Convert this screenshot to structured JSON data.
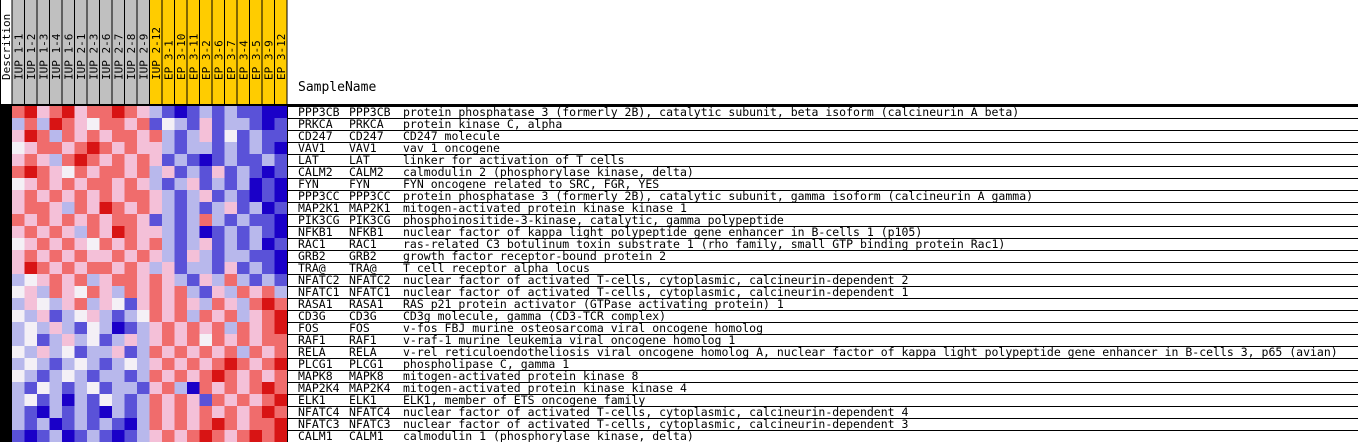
{
  "header": {
    "sample_name_label": "SampleName"
  },
  "chart_data": {
    "type": "heatmap",
    "description_label": "Descrition",
    "columns": [
      {
        "name": "IUP_1-1",
        "group": "IUP"
      },
      {
        "name": "IUP_1-2",
        "group": "IUP"
      },
      {
        "name": "IUP_1-3",
        "group": "IUP"
      },
      {
        "name": "IUP_1-4",
        "group": "IUP"
      },
      {
        "name": "IUP_1-6",
        "group": "IUP"
      },
      {
        "name": "IUP_2-1",
        "group": "IUP"
      },
      {
        "name": "IUP_2-3",
        "group": "IUP"
      },
      {
        "name": "IUP_2-6",
        "group": "IUP"
      },
      {
        "name": "IUP_2-7",
        "group": "IUP"
      },
      {
        "name": "IUP_2-8",
        "group": "IUP"
      },
      {
        "name": "IUP_2-9",
        "group": "IUP"
      },
      {
        "name": "IUP_2-12",
        "group": "EP"
      },
      {
        "name": "EP_3-1",
        "group": "EP"
      },
      {
        "name": "EP_3-10",
        "group": "EP"
      },
      {
        "name": "EP_3-11",
        "group": "EP"
      },
      {
        "name": "EP_3-2",
        "group": "EP"
      },
      {
        "name": "EP_3-6",
        "group": "EP"
      },
      {
        "name": "EP_3-7",
        "group": "EP"
      },
      {
        "name": "EP_3-4",
        "group": "EP"
      },
      {
        "name": "EP_3-5",
        "group": "EP"
      },
      {
        "name": "EP_3-9",
        "group": "EP"
      },
      {
        "name": "EP_3-12",
        "group": "EP"
      }
    ],
    "group_colors": {
      "IUP": "#c0c0c0",
      "EP": "#ffcc00"
    },
    "color_scale": {
      "-3": "#1a00c8",
      "-2": "#5a52d8",
      "-1": "#b8b8ec",
      "0": "#f4f0f6",
      "1": "#f4c0d8",
      "2": "#f06c6c",
      "3": "#d81414"
    },
    "rows": [
      {
        "symbol": "PPP3CB",
        "gene": "PPP3CB",
        "description": "protein phosphatase 3 (formerly 2B), catalytic subunit, beta isoform (calcineurin A beta)",
        "values": [
          2,
          3,
          1,
          2,
          3,
          1,
          2,
          2,
          3,
          2,
          1,
          -1,
          -2,
          -3,
          -2,
          -1,
          -2,
          -1,
          -2,
          -2,
          -3,
          -3
        ]
      },
      {
        "symbol": "PRKCA",
        "gene": "PRKCA",
        "description": "protein kinase C, alpha",
        "values": [
          -1,
          2,
          -1,
          3,
          2,
          1,
          0,
          2,
          2,
          1,
          2,
          -2,
          0,
          -1,
          -2,
          1,
          -2,
          -1,
          -1,
          -2,
          -3,
          -2
        ]
      },
      {
        "symbol": "CD247",
        "gene": "CD247",
        "description": "CD247 molecule",
        "values": [
          1,
          3,
          2,
          -1,
          2,
          1,
          2,
          1,
          2,
          2,
          1,
          2,
          -1,
          -2,
          -1,
          1,
          -2,
          0,
          -2,
          -1,
          -2,
          -2
        ]
      },
      {
        "symbol": "VAV1",
        "gene": "VAV1",
        "description": "vav 1 oncogene",
        "values": [
          0,
          1,
          2,
          2,
          1,
          2,
          3,
          2,
          1,
          2,
          1,
          1,
          -1,
          -2,
          -1,
          -1,
          -2,
          -1,
          -2,
          -1,
          -2,
          -3
        ]
      },
      {
        "symbol": "LAT",
        "gene": "LAT",
        "description": "linker for activation of T cells",
        "values": [
          1,
          2,
          1,
          -1,
          2,
          3,
          2,
          1,
          2,
          1,
          2,
          1,
          -2,
          -1,
          -2,
          -3,
          -2,
          -1,
          -2,
          -2,
          -1,
          -2
        ]
      },
      {
        "symbol": "CALM2",
        "gene": "CALM2",
        "description": "calmodulin 2 (phosphorylase kinase, delta)",
        "values": [
          2,
          3,
          2,
          1,
          0,
          2,
          1,
          2,
          2,
          1,
          2,
          -1,
          1,
          -2,
          -1,
          -2,
          1,
          -2,
          -1,
          -2,
          -3,
          -2
        ]
      },
      {
        "symbol": "FYN",
        "gene": "FYN",
        "description": "FYN oncogene related to SRC, FGR, YES",
        "values": [
          0,
          1,
          2,
          1,
          2,
          1,
          2,
          2,
          1,
          2,
          1,
          -1,
          -2,
          -1,
          1,
          -2,
          -1,
          -2,
          -1,
          -3,
          -2,
          -3
        ]
      },
      {
        "symbol": "PPP3CC",
        "gene": "PPP3CC",
        "description": "protein phosphatase 3 (formerly 2B), catalytic subunit, gamma isoform (calcineurin A gamma)",
        "values": [
          1,
          2,
          1,
          2,
          1,
          2,
          1,
          2,
          1,
          2,
          2,
          1,
          -1,
          -2,
          -1,
          1,
          -2,
          -1,
          -2,
          -3,
          -2,
          -3
        ]
      },
      {
        "symbol": "MAP2K1",
        "gene": "MAP2K1",
        "description": "mitogen-activated protein kinase kinase 1",
        "values": [
          1,
          2,
          2,
          1,
          -1,
          2,
          1,
          3,
          2,
          1,
          2,
          1,
          -1,
          -2,
          -1,
          -2,
          -1,
          1,
          -2,
          -1,
          -3,
          -2
        ]
      },
      {
        "symbol": "PIK3CG",
        "gene": "PIK3CG",
        "description": "phosphoinositide-3-kinase, catalytic, gamma polypeptide",
        "values": [
          2,
          1,
          2,
          1,
          2,
          1,
          2,
          1,
          2,
          2,
          1,
          -2,
          -1,
          -2,
          -1,
          2,
          -1,
          -2,
          -1,
          -2,
          -2,
          -3
        ]
      },
      {
        "symbol": "NFKB1",
        "gene": "NFKB1",
        "description": "nuclear factor of kappa light polypeptide gene enhancer in B-cells 1 (p105)",
        "values": [
          1,
          2,
          1,
          2,
          1,
          -1,
          2,
          1,
          3,
          2,
          1,
          1,
          -1,
          -2,
          -1,
          -3,
          -2,
          -1,
          -2,
          -1,
          -2,
          -3
        ]
      },
      {
        "symbol": "RAC1",
        "gene": "RAC1",
        "description": "ras-related C3 botulinum toxin substrate 1 (rho family, small GTP binding protein Rac1)",
        "values": [
          0,
          1,
          2,
          1,
          2,
          1,
          0,
          2,
          1,
          2,
          1,
          2,
          -1,
          -2,
          -1,
          1,
          -2,
          -1,
          -2,
          -1,
          -3,
          -2
        ]
      },
      {
        "symbol": "GRB2",
        "gene": "GRB2",
        "description": "growth factor receptor-bound protein 2",
        "values": [
          1,
          2,
          1,
          2,
          1,
          2,
          1,
          1,
          2,
          1,
          2,
          1,
          -1,
          -2,
          1,
          -1,
          -2,
          -1,
          -1,
          -2,
          -2,
          -3
        ]
      },
      {
        "symbol": "TRA@",
        "gene": "TRA@",
        "description": "T cell receptor alpha locus",
        "values": [
          1,
          3,
          2,
          1,
          2,
          1,
          2,
          2,
          1,
          2,
          1,
          -1,
          1,
          -2,
          -1,
          -1,
          -2,
          1,
          -2,
          -1,
          -2,
          -3
        ]
      },
      {
        "symbol": "NFATC2",
        "gene": "NFATC2",
        "description": "nuclear factor of activated T-cells, cytoplasmic, calcineurin-dependent 2",
        "values": [
          -1,
          0,
          1,
          2,
          1,
          2,
          -1,
          1,
          2,
          2,
          1,
          2,
          1,
          -1,
          -2,
          1,
          -1,
          2,
          -1,
          -2,
          -1,
          -2
        ]
      },
      {
        "symbol": "NFATC1",
        "gene": "NFATC1",
        "description": "nuclear factor of activated T-cells, cytoplasmic, calcineurin-dependent 1",
        "values": [
          0,
          1,
          -1,
          2,
          1,
          0,
          2,
          1,
          -1,
          2,
          1,
          2,
          1,
          2,
          -1,
          -2,
          1,
          -1,
          2,
          1,
          2,
          -1
        ]
      },
      {
        "symbol": "RASA1",
        "gene": "RASA1",
        "description": "RAS p21 protein activator (GTPase activating protein) 1",
        "values": [
          -1,
          1,
          0,
          -1,
          1,
          2,
          -1,
          1,
          0,
          -2,
          1,
          2,
          1,
          2,
          1,
          -1,
          2,
          1,
          -1,
          2,
          3,
          2
        ]
      },
      {
        "symbol": "CD3G",
        "gene": "CD3G",
        "description": "CD3g molecule, gamma (CD3-TCR complex)",
        "values": [
          0,
          -1,
          1,
          -2,
          -1,
          0,
          1,
          -1,
          -2,
          -1,
          0,
          2,
          1,
          2,
          -1,
          2,
          1,
          2,
          -1,
          1,
          2,
          3
        ]
      },
      {
        "symbol": "FOS",
        "gene": "FOS",
        "description": "v-fos FBJ murine osteosarcoma viral oncogene homolog",
        "values": [
          -1,
          0,
          -1,
          1,
          -1,
          -2,
          0,
          -1,
          -3,
          -2,
          -1,
          1,
          2,
          1,
          2,
          1,
          2,
          -1,
          2,
          1,
          2,
          3
        ]
      },
      {
        "symbol": "RAF1",
        "gene": "RAF1",
        "description": "v-raf-1 murine leukemia viral oncogene homolog 1",
        "values": [
          -1,
          0,
          -2,
          -1,
          1,
          -1,
          0,
          -2,
          -1,
          1,
          -1,
          1,
          2,
          1,
          2,
          0,
          2,
          1,
          2,
          1,
          2,
          2
        ]
      },
      {
        "symbol": "RELA",
        "gene": "RELA",
        "description": "v-rel reticuloendotheliosis viral oncogene homolog A, nuclear factor of kappa light polypeptide gene enhancer in B-cells 3, p65 (avian)",
        "values": [
          0,
          -1,
          1,
          -1,
          0,
          -2,
          -1,
          -1,
          1,
          -2,
          -1,
          2,
          1,
          2,
          1,
          2,
          1,
          2,
          -1,
          2,
          1,
          2
        ]
      },
      {
        "symbol": "PLCG1",
        "gene": "PLCG1",
        "description": "phospholipase C, gamma 1",
        "values": [
          -1,
          0,
          -1,
          -2,
          -1,
          0,
          -1,
          -2,
          -1,
          0,
          -1,
          1,
          2,
          1,
          2,
          1,
          2,
          3,
          2,
          1,
          2,
          3
        ]
      },
      {
        "symbol": "MAPK8",
        "gene": "MAPK8",
        "description": "mitogen-activated protein kinase 8",
        "values": [
          0,
          -1,
          -2,
          -1,
          0,
          -1,
          -2,
          -1,
          -1,
          -2,
          -1,
          2,
          1,
          2,
          1,
          2,
          3,
          2,
          1,
          2,
          1,
          2
        ]
      },
      {
        "symbol": "MAP2K4",
        "gene": "MAP2K4",
        "description": "mitogen-activated protein kinase kinase 4",
        "values": [
          -1,
          -2,
          0,
          -1,
          -2,
          -1,
          0,
          -2,
          -1,
          -1,
          -2,
          1,
          2,
          -1,
          -3,
          2,
          1,
          2,
          1,
          2,
          3,
          2
        ]
      },
      {
        "symbol": "ELK1",
        "gene": "ELK1",
        "description": "ELK1, member of ETS oncogene family",
        "values": [
          -1,
          0,
          -2,
          -1,
          -3,
          -1,
          -2,
          0,
          -1,
          -2,
          -1,
          2,
          1,
          2,
          1,
          -2,
          2,
          1,
          2,
          1,
          2,
          3
        ]
      },
      {
        "symbol": "NFATC4",
        "gene": "NFATC4",
        "description": "nuclear factor of activated T-cells, cytoplasmic, calcineurin-dependent 4",
        "values": [
          -1,
          -2,
          -3,
          -1,
          -2,
          -1,
          -2,
          -3,
          -1,
          -2,
          -1,
          2,
          1,
          2,
          1,
          2,
          1,
          2,
          1,
          2,
          3,
          2
        ]
      },
      {
        "symbol": "NFATC3",
        "gene": "NFATC3",
        "description": "nuclear factor of activated T-cells, cytoplasmic, calcineurin-dependent 3",
        "values": [
          -1,
          -2,
          -1,
          -3,
          -2,
          -1,
          -2,
          -1,
          -2,
          -3,
          -1,
          2,
          1,
          2,
          1,
          2,
          3,
          2,
          1,
          2,
          2,
          3
        ]
      },
      {
        "symbol": "CALM1",
        "gene": "CALM1",
        "description": "calmodulin 1 (phosphorylase kinase, delta)",
        "values": [
          -2,
          -3,
          -2,
          -1,
          -3,
          -2,
          -1,
          -2,
          -3,
          -2,
          -1,
          1,
          2,
          1,
          2,
          3,
          2,
          1,
          2,
          3,
          2,
          3
        ]
      }
    ]
  }
}
